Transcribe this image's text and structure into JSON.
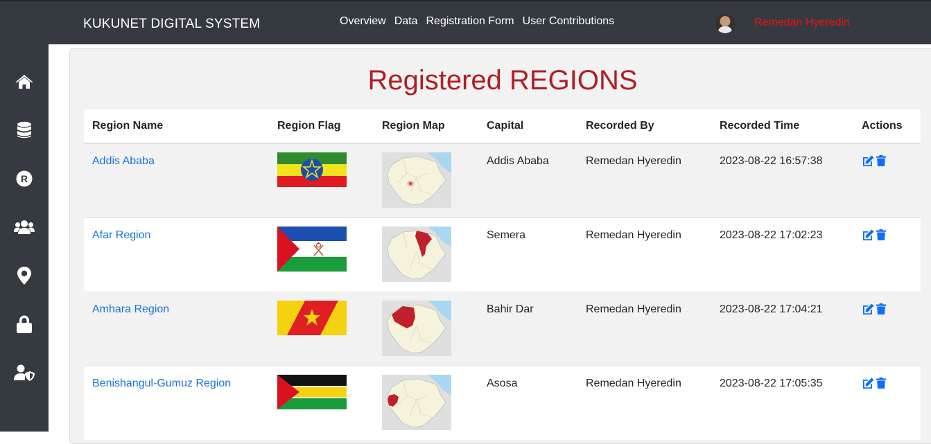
{
  "header": {
    "brand": "KUKUNET DIGITAL SYSTEM",
    "nav": [
      "Overview",
      "Data",
      "Registration Form",
      "User Contributions"
    ],
    "user_name": "Remedan Hyeredin"
  },
  "sidebar": {
    "items": [
      "home-icon",
      "database-icon",
      "registered-icon",
      "users-icon",
      "map-marker-icon",
      "lock-icon",
      "user-shield-icon"
    ]
  },
  "page": {
    "title": "Registered REGIONS"
  },
  "table": {
    "columns": [
      "Region Name",
      "Region Flag",
      "Region Map",
      "Capital",
      "Recorded By",
      "Recorded Time",
      "Actions"
    ],
    "rows": [
      {
        "name": "Addis Ababa",
        "capital": "Addis Ababa",
        "recorded_by": "Remedan Hyeredin",
        "recorded_time": "2023-08-22 16:57:38"
      },
      {
        "name": "Afar Region",
        "capital": "Semera",
        "recorded_by": "Remedan Hyeredin",
        "recorded_time": "2023-08-22 17:02:23"
      },
      {
        "name": "Amhara Region",
        "capital": "Bahir Dar",
        "recorded_by": "Remedan Hyeredin",
        "recorded_time": "2023-08-22 17:04:21"
      },
      {
        "name": "Benishangul-Gumuz Region",
        "capital": "Asosa",
        "recorded_by": "Remedan Hyeredin",
        "recorded_time": "2023-08-22 17:05:35"
      }
    ]
  },
  "colors": {
    "topbar": "#343a40",
    "title": "#b01e23",
    "username": "#e8141a",
    "link": "#1a73d9",
    "action": "#0d6efd"
  }
}
